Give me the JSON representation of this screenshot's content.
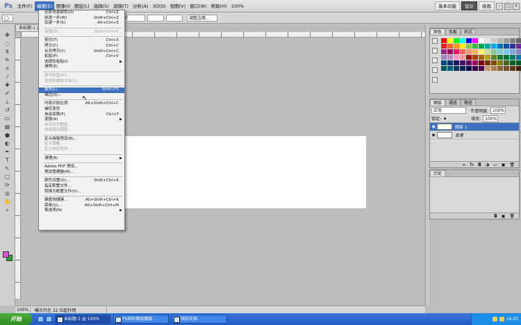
{
  "app": {
    "logo": "Ps",
    "menu": [
      "文件(F)",
      "编辑(E)",
      "图像(I)",
      "图层(L)",
      "选择(S)",
      "滤镜(T)",
      "分析(A)",
      "3D(D)",
      "视图(V)",
      "窗口(W)",
      "帮助(H)"
    ],
    "active_menu_index": 1,
    "zoom": "100%",
    "workspaces": [
      "基本功能",
      "设计",
      "绘画"
    ],
    "active_workspace_index": 1
  },
  "options": {
    "feather": "正常",
    "refine_edge": "调整边缘..."
  },
  "document": {
    "tab_title": "未标题-1 @ 1...",
    "zoom": "100%",
    "status": "曝光只在 32 位起作用"
  },
  "edit_menu": {
    "items": [
      {
        "label": "还原背景颜色(O)",
        "shortcut": "Ctrl+Z",
        "disabled": false
      },
      {
        "label": "前进一步(W)",
        "shortcut": "Shift+Ctrl+Z",
        "disabled": false
      },
      {
        "label": "后退一步(K)",
        "shortcut": "Alt+Ctrl+Z",
        "disabled": false
      },
      {
        "sep": true
      },
      {
        "label": "渐隐(D)...",
        "shortcut": "Shift+Ctrl+F",
        "disabled": true
      },
      {
        "sep": true
      },
      {
        "label": "剪切(T)",
        "shortcut": "Ctrl+X",
        "disabled": false
      },
      {
        "label": "拷贝(C)",
        "shortcut": "Ctrl+C",
        "disabled": false
      },
      {
        "label": "合并拷贝(Y)",
        "shortcut": "Shift+Ctrl+C",
        "disabled": false
      },
      {
        "label": "粘贴(P)",
        "shortcut": "Ctrl+V",
        "disabled": false
      },
      {
        "label": "选择性粘贴(I)",
        "shortcut": "",
        "disabled": false,
        "submenu": true
      },
      {
        "label": "清除(E)",
        "shortcut": "",
        "disabled": false
      },
      {
        "sep": true
      },
      {
        "label": "拼写检查(H)...",
        "shortcut": "",
        "disabled": true
      },
      {
        "label": "查找和替换文本(X)...",
        "shortcut": "",
        "disabled": true
      },
      {
        "sep": true
      },
      {
        "label": "填充(L)...",
        "shortcut": "Shift+F5",
        "disabled": false,
        "highlight": true
      },
      {
        "label": "描边(S)...",
        "shortcut": "",
        "disabled": false
      },
      {
        "sep": true
      },
      {
        "label": "内容识别比例",
        "shortcut": "Alt+Shift+Ctrl+C",
        "disabled": false
      },
      {
        "label": "操控变形",
        "shortcut": "",
        "disabled": false
      },
      {
        "label": "自由变换(F)",
        "shortcut": "Ctrl+T",
        "disabled": false
      },
      {
        "label": "变换(A)",
        "shortcut": "",
        "disabled": false,
        "submenu": true
      },
      {
        "label": "自动对齐图层...",
        "shortcut": "",
        "disabled": true
      },
      {
        "label": "自动混合图层...",
        "shortcut": "",
        "disabled": true
      },
      {
        "sep": true
      },
      {
        "label": "定义画笔预设(B)...",
        "shortcut": "",
        "disabled": false
      },
      {
        "label": "定义图案...",
        "shortcut": "",
        "disabled": true
      },
      {
        "label": "定义自定形状...",
        "shortcut": "",
        "disabled": true
      },
      {
        "sep": true
      },
      {
        "label": "清理(R)",
        "shortcut": "",
        "disabled": false,
        "submenu": true
      },
      {
        "sep": true
      },
      {
        "label": "Adobe PDF 预设...",
        "shortcut": "",
        "disabled": false
      },
      {
        "label": "预设管理器(M)...",
        "shortcut": "",
        "disabled": false
      },
      {
        "sep": true
      },
      {
        "label": "颜色设置(G)...",
        "shortcut": "Shift+Ctrl+K",
        "disabled": false
      },
      {
        "label": "指定配置文件...",
        "shortcut": "",
        "disabled": false
      },
      {
        "label": "转换为配置文件(V)...",
        "shortcut": "",
        "disabled": false
      },
      {
        "sep": true
      },
      {
        "label": "键盘快捷键...",
        "shortcut": "Alt+Shift+Ctrl+K",
        "disabled": false
      },
      {
        "label": "菜单(U)...",
        "shortcut": "Alt+Shift+Ctrl+M",
        "disabled": false
      },
      {
        "label": "首选项(N)",
        "shortcut": "",
        "disabled": false,
        "submenu": true
      }
    ]
  },
  "swatches_panel": {
    "tabs": [
      "颜色",
      "色板",
      "样式"
    ],
    "active_tab_index": 0,
    "colors": [
      "#ff0000",
      "#ffff00",
      "#00ff00",
      "#00ffff",
      "#0000ff",
      "#ff00ff",
      "#ffffff",
      "#e6e6e6",
      "#cccccc",
      "#b3b3b3",
      "#999999",
      "#808080",
      "#666666",
      "#ee1c24",
      "#f26522",
      "#f7941d",
      "#fff200",
      "#8dc63f",
      "#39b54a",
      "#00a651",
      "#00a99d",
      "#00aeef",
      "#0072bc",
      "#0054a6",
      "#2e3192",
      "#662d91",
      "#92278f",
      "#9e005d",
      "#ed145b",
      "#f26c4f",
      "#f69679",
      "#fbaf5d",
      "#fff568",
      "#c4df9b",
      "#82ca9c",
      "#7accc8",
      "#6dcff6",
      "#7da7d8",
      "#8781bd",
      "#a186be",
      "#bd8cbf",
      "#f49ac2",
      "#f5989d",
      "#9e0b0f",
      "#a0410d",
      "#a36209",
      "#aba000",
      "#598527",
      "#197b30",
      "#007236",
      "#00746b",
      "#0076a3",
      "#004a80",
      "#003471",
      "#1b1464",
      "#440e62",
      "#630460",
      "#9e005d",
      "#790000",
      "#7b2e00",
      "#7d4900",
      "#827b00",
      "#406618",
      "#005e20",
      "#005826",
      "#005952",
      "#005b7f",
      "#003663",
      "#002157",
      "#0d004c",
      "#32004b",
      "#4b0049",
      "#c69c6d",
      "#a67c52",
      "#8c6239",
      "#754c24",
      "#603913",
      "#42210b"
    ]
  },
  "layers_panel": {
    "tabs": [
      "图层",
      "通道",
      "路径"
    ],
    "active_tab_index": 0,
    "blend_mode": "正常",
    "opacity_label": "不透明度:",
    "opacity": "100%",
    "lock_label": "锁定:",
    "fill_label": "填充:",
    "fill": "100%",
    "layers": [
      {
        "name": "图层 1",
        "selected": true
      },
      {
        "name": "背景",
        "selected": false
      }
    ]
  },
  "bottom_panel": {
    "tabs": [
      "历史"
    ]
  },
  "taskbar": {
    "start": "开始",
    "tasks": [
      "未标题-1 @ 100%",
      "PS矩形图层面板...",
      "我的文档"
    ],
    "active_task_index": 0,
    "time": "14:23"
  }
}
